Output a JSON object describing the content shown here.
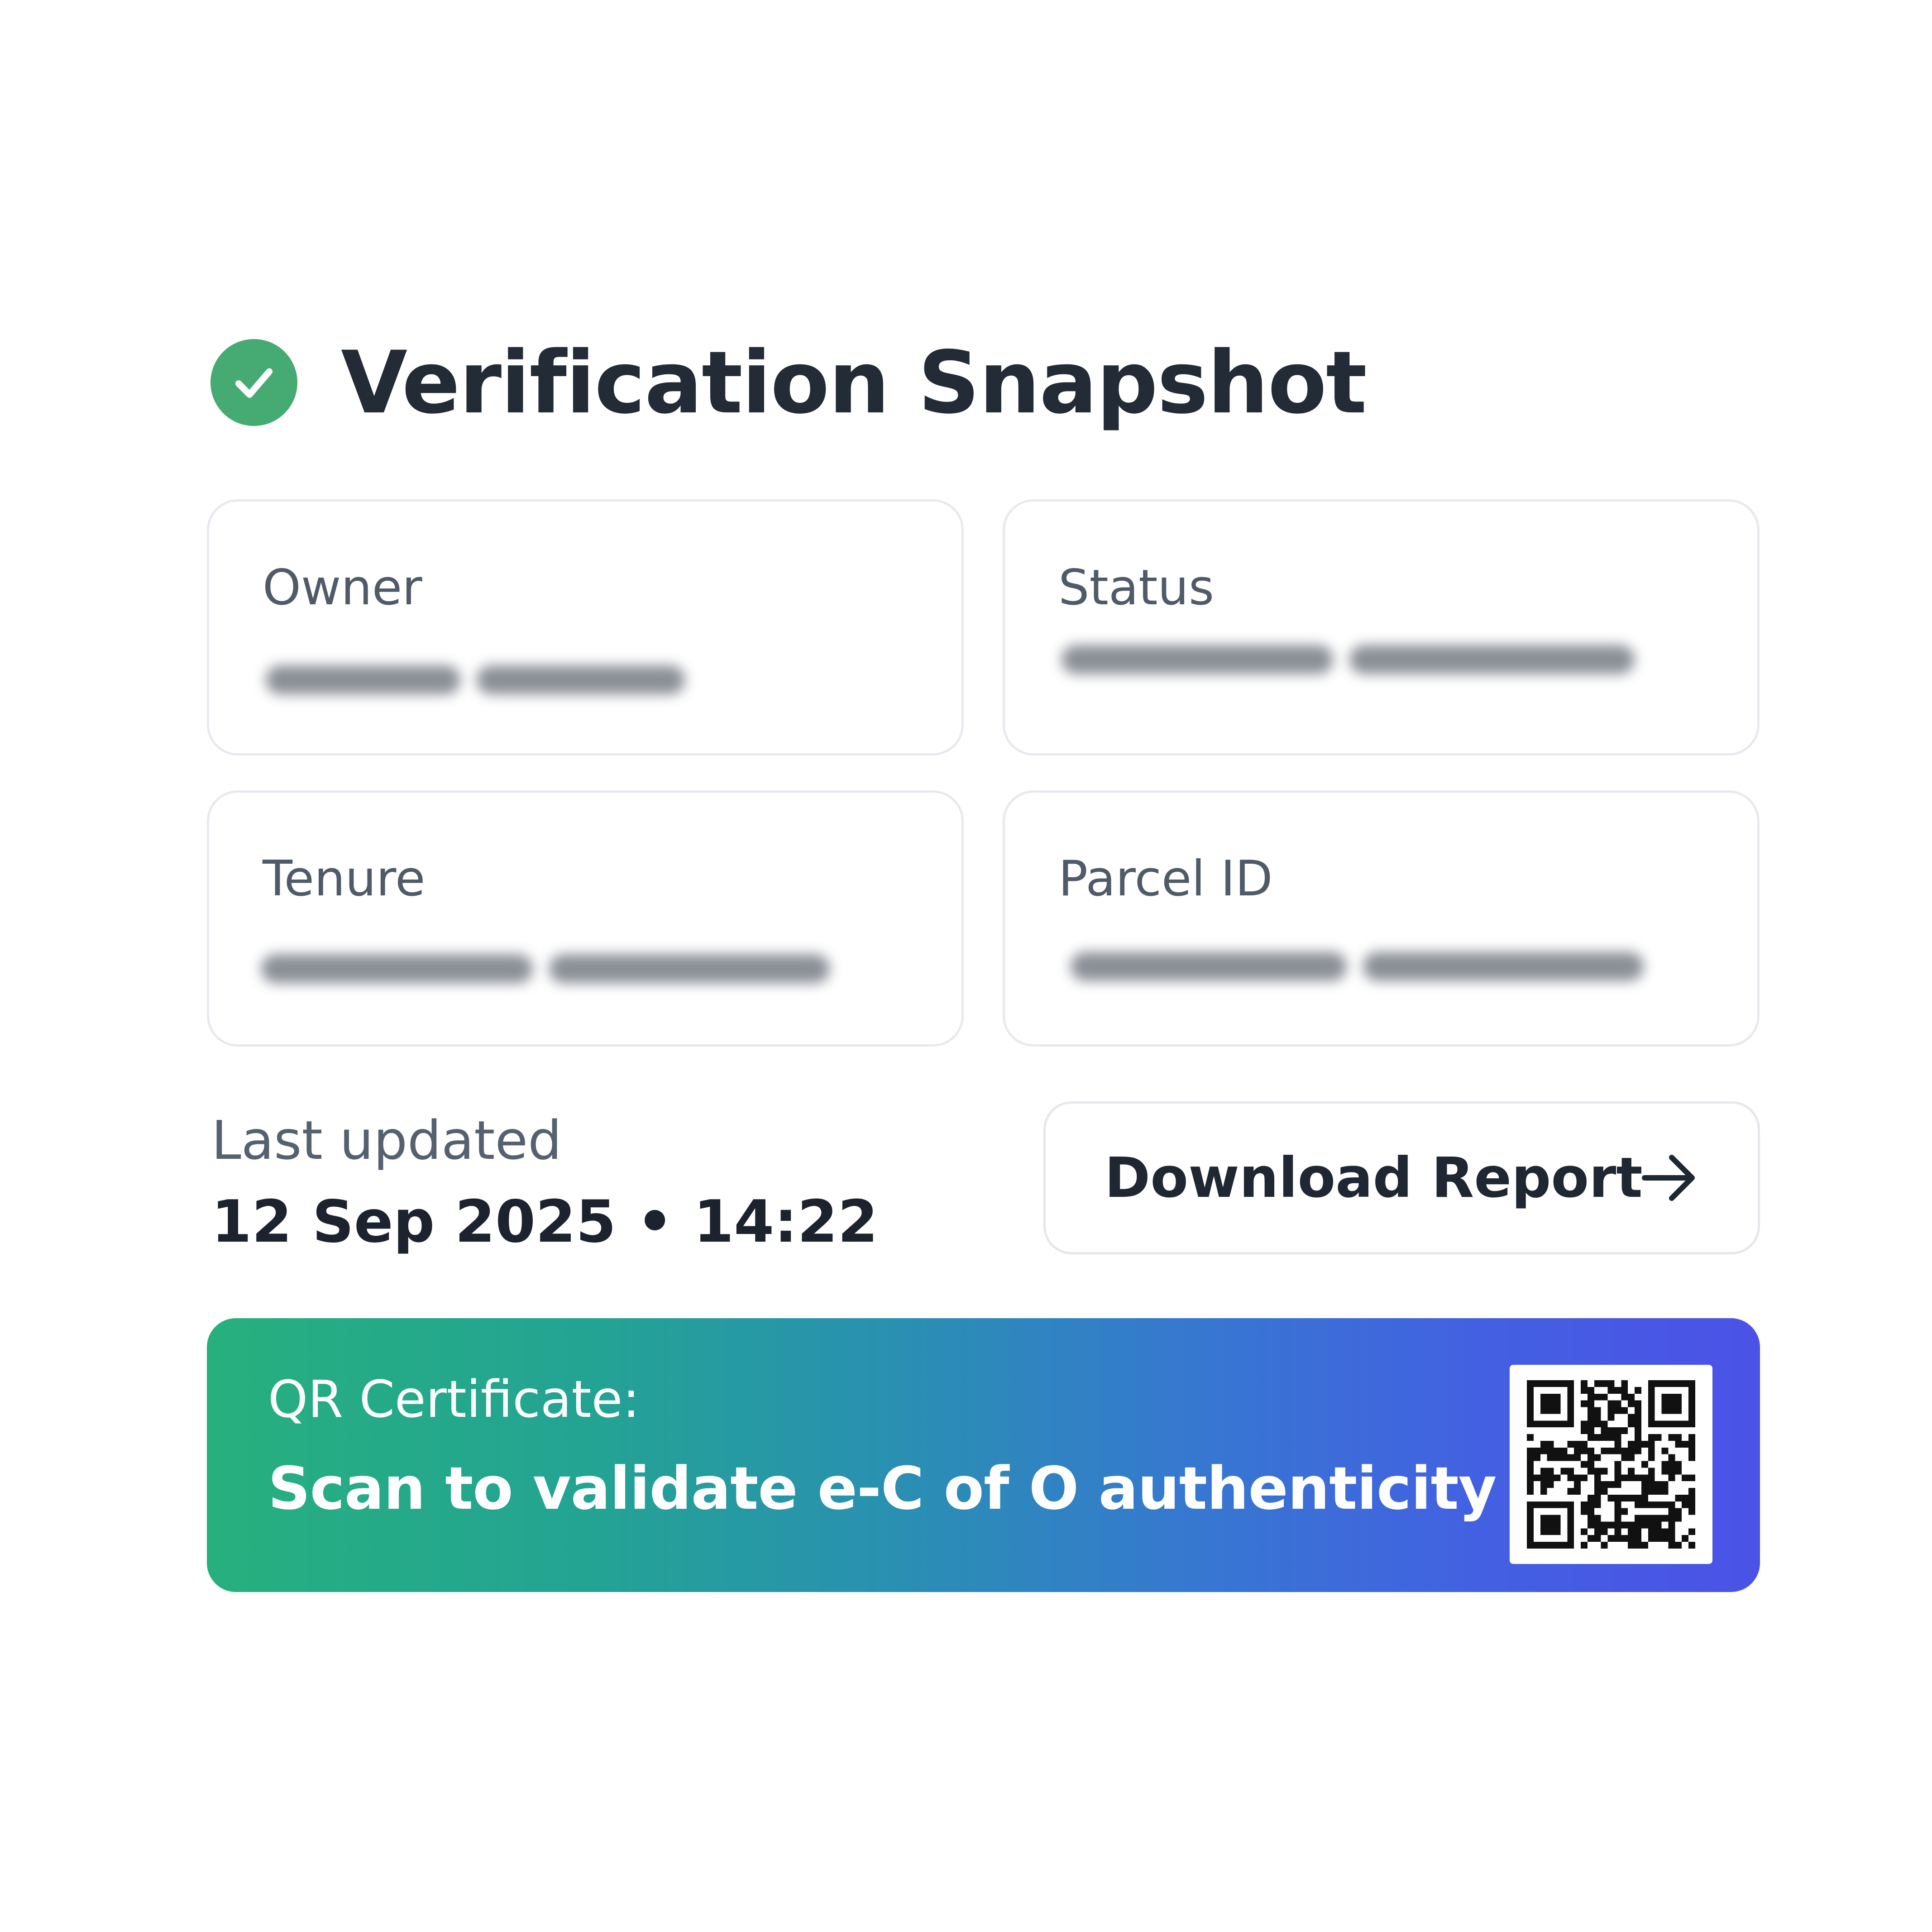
{
  "header": {
    "title": "Verification Snapshot",
    "icon": "check-circle-icon",
    "icon_color": "#46ab72"
  },
  "cards": {
    "owner": {
      "label": "Owner"
    },
    "status": {
      "label": "Status"
    },
    "tenure": {
      "label": "Tenure"
    },
    "parcel": {
      "label": "Parcel ID"
    }
  },
  "last_updated": {
    "label": "Last updated",
    "value": "12 Sep 2025 • 14:22"
  },
  "download": {
    "label": "Download Report",
    "icon": "arrow-right-icon"
  },
  "qr_banner": {
    "line1": "QR Certificate:",
    "line2": "Scan to validate e-C of O authenticity",
    "gradient_start": "#27b07e",
    "gradient_end": "#4b52e6"
  }
}
